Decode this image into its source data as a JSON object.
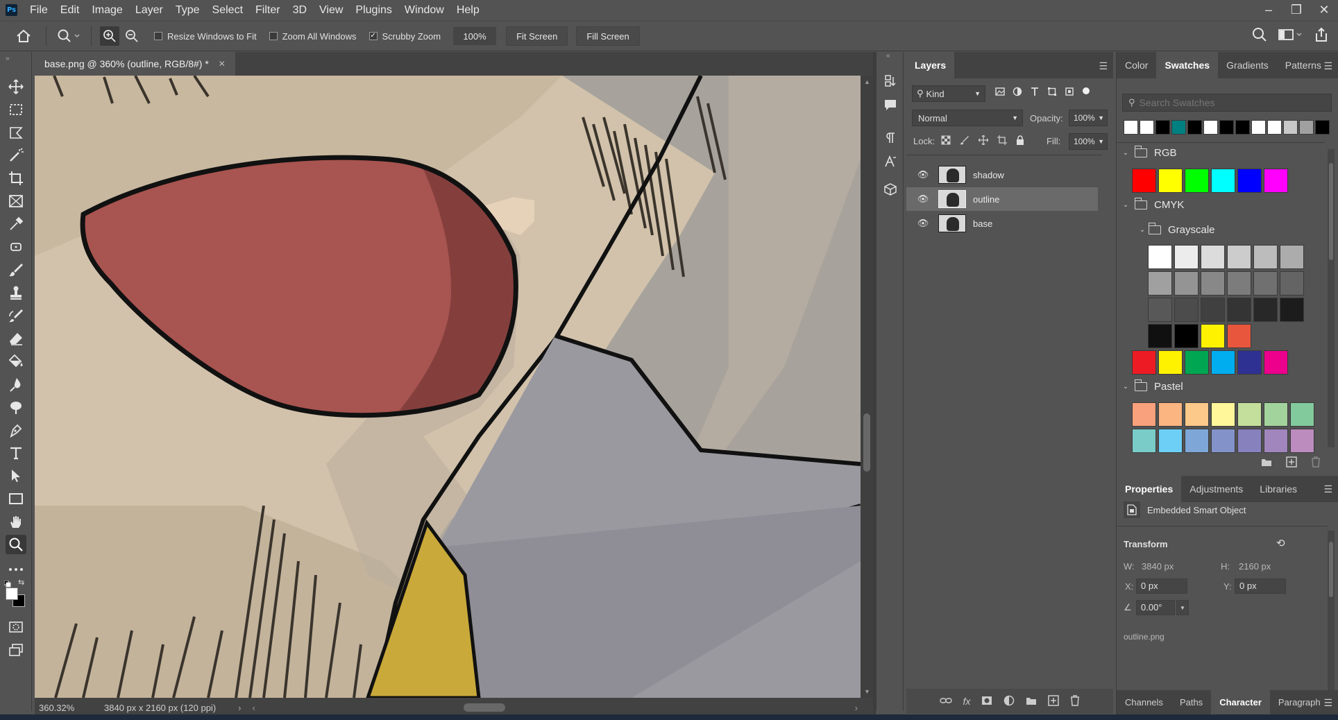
{
  "app": {
    "logo_text": "Ps"
  },
  "menu": [
    "File",
    "Edit",
    "Image",
    "Layer",
    "Type",
    "Select",
    "Filter",
    "3D",
    "View",
    "Plugins",
    "Window",
    "Help"
  ],
  "window_controls": {
    "minimize": "–",
    "restore": "❐",
    "close": "✕"
  },
  "options_bar": {
    "resize_windows_label": "Resize Windows to Fit",
    "zoom_all_label": "Zoom All Windows",
    "scrubby_label": "Scrubby Zoom",
    "zoom_value": "100%",
    "fit_screen": "Fit Screen",
    "fill_screen": "Fill Screen",
    "scrubby_checked": true
  },
  "document": {
    "tab_title": "base.png @ 360% (outline, RGB/8#) *",
    "zoom": "360.32%",
    "doc_info": "3840 px x 2160 px (120 ppi)"
  },
  "layers_panel": {
    "tab": "Layers",
    "filter_kind": "Kind",
    "blend_mode": "Normal",
    "opacity_label": "Opacity:",
    "opacity_value": "100%",
    "lock_label": "Lock:",
    "fill_label": "Fill:",
    "fill_value": "100%",
    "layers": [
      {
        "name": "shadow",
        "selected": false
      },
      {
        "name": "outline",
        "selected": true
      },
      {
        "name": "base",
        "selected": false
      }
    ]
  },
  "swatches_panel": {
    "tabs": [
      "Color",
      "Swatches",
      "Gradients",
      "Patterns"
    ],
    "active_tab": "Swatches",
    "search_placeholder": "Search Swatches",
    "recent": [
      "#ffffff",
      "#ffffff",
      "#000000",
      "#008080",
      "#000000",
      "#ffffff",
      "#000000",
      "#000000",
      "#ffffff",
      "#ffffff",
      "#c8c8c8",
      "#a0a0a0",
      "#000000"
    ],
    "groups": {
      "rgb": {
        "name": "RGB",
        "colors": [
          "#ff0000",
          "#ffff00",
          "#00ff00",
          "#00ffff",
          "#0000ff",
          "#ff00ff"
        ]
      },
      "cmyk": {
        "name": "CMYK",
        "colors": [
          "#ed1c24",
          "#fff200",
          "#00a651",
          "#00aeef",
          "#2e3192",
          "#ec008c"
        ]
      },
      "grayscale": {
        "name": "Grayscale",
        "colors": [
          "#ffffff",
          "#ececec",
          "#dcdcdc",
          "#cccccc",
          "#bcbcbc",
          "#acacac",
          "#a0a0a0",
          "#949494",
          "#888888",
          "#7c7c7c",
          "#707070",
          "#646464",
          "#585858",
          "#4c4c4c",
          "#404040",
          "#343434",
          "#282828",
          "#1c1c1c",
          "#101010",
          "#000000",
          "#fff200",
          "#e8563d"
        ]
      },
      "pastel": {
        "name": "Pastel",
        "colors": [
          "#f9a07c",
          "#fbb580",
          "#fdc98a",
          "#fff799",
          "#c4df9b",
          "#a3d39c",
          "#82ca9c",
          "#7accc8",
          "#6dcff6",
          "#7ea7d8",
          "#8393ca",
          "#8781bd",
          "#a186be",
          "#bd8cbf"
        ]
      }
    }
  },
  "properties_panel": {
    "tabs": [
      "Properties",
      "Adjustments",
      "Libraries"
    ],
    "active_tab": "Properties",
    "object_type": "Embedded Smart Object",
    "transform_label": "Transform",
    "w_label": "W:",
    "w_value": "3840 px",
    "h_label": "H:",
    "h_value": "2160 px",
    "x_label": "X:",
    "x_value": "0 px",
    "y_label": "Y:",
    "y_value": "0 px",
    "angle_value": "0.00°",
    "filename": "outline.png"
  },
  "bottom_tabs": [
    "Channels",
    "Paths",
    "Character",
    "Paragraph"
  ],
  "bottom_active": "Character"
}
